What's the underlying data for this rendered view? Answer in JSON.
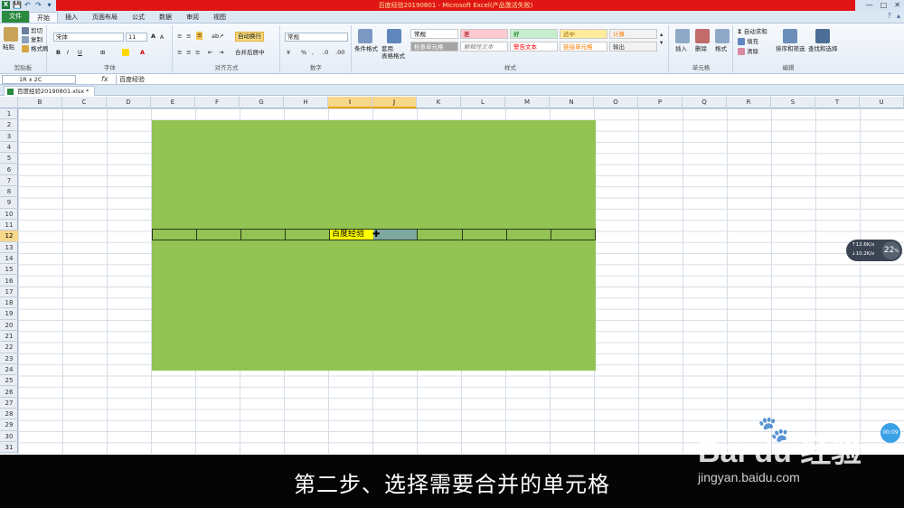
{
  "window": {
    "title": "百度经验20190801 - Microsoft Excel(产品激活失败)",
    "controls": [
      "—",
      "□",
      "✕"
    ]
  },
  "qat": {
    "excel_icon": "X",
    "save": "💾",
    "undo": "↶",
    "redo": "↷",
    "more": "▾"
  },
  "ribbon_tabs": [
    "文件",
    "开始",
    "插入",
    "页面布局",
    "公式",
    "数据",
    "审阅",
    "视图"
  ],
  "active_tab": "开始",
  "clipboard": {
    "paste": "粘贴",
    "cut": "剪切",
    "copy": "复制",
    "painter": "格式刷",
    "label": "剪贴板"
  },
  "font": {
    "name": "宋体",
    "size": "11",
    "grow": "A",
    "shrink": "A",
    "bold": "B",
    "italic": "I",
    "underline": "U",
    "label": "字体"
  },
  "alignment": {
    "wrap": "自动换行",
    "merge": "合并后居中",
    "label": "对齐方式"
  },
  "number": {
    "format": "常规",
    "percent": "%",
    "comma": ",",
    "label": "数字"
  },
  "styles": {
    "conditional": "条件格式",
    "table": "套用\n表格格式",
    "cells": [
      {
        "text": "常规",
        "bg": "#ffffff",
        "fg": "#000000"
      },
      {
        "text": "差",
        "bg": "#ffc7ce",
        "fg": "#9c0006"
      },
      {
        "text": "好",
        "bg": "#c6efce",
        "fg": "#006100"
      },
      {
        "text": "适中",
        "bg": "#ffeb9c",
        "fg": "#9c6500"
      },
      {
        "text": "计算",
        "bg": "#f2f2f2",
        "fg": "#fa7d00"
      },
      {
        "text": "检查单元格",
        "bg": "#a5a5a5",
        "fg": "#ffffff"
      },
      {
        "text": "解释性文本",
        "bg": "#ffffff",
        "fg": "#7f7f7f"
      },
      {
        "text": "警告文本",
        "bg": "#ffffff",
        "fg": "#ff0000"
      },
      {
        "text": "链接单元格",
        "bg": "#ffffff",
        "fg": "#fa7d00"
      },
      {
        "text": "输出",
        "bg": "#f2f2f2",
        "fg": "#3f3f3f"
      }
    ],
    "label": "样式"
  },
  "cells_group": {
    "insert": "插入",
    "delete": "删除",
    "format": "格式",
    "label": "单元格"
  },
  "editing": {
    "autosum": "自动求和",
    "fill": "填充",
    "clear": "清除",
    "sort": "排序和筛选",
    "find": "查找和选择",
    "label": "编辑"
  },
  "formula_bar": {
    "name_box": "1R x 2C",
    "fx": "fx",
    "content": "百度经验"
  },
  "workbook_tab": "百度经验20190801.xlsx *",
  "columns": [
    "B",
    "C",
    "D",
    "E",
    "F",
    "G",
    "H",
    "I",
    "J",
    "K",
    "L",
    "M",
    "N",
    "O",
    "P",
    "Q",
    "R",
    "S",
    "T",
    "U"
  ],
  "selected_columns": [
    "I",
    "J"
  ],
  "rows": [
    "1",
    "2",
    "3",
    "4",
    "5",
    "6",
    "7",
    "8",
    "9",
    "10",
    "11",
    "12",
    "13",
    "14",
    "15",
    "16",
    "17",
    "18",
    "19",
    "20",
    "21",
    "22",
    "23",
    "24",
    "25",
    "26",
    "27",
    "28",
    "29",
    "30",
    "31"
  ],
  "selected_row": "12",
  "active_cell_text": "百度经验",
  "sheet_colors": {
    "block": "#92c353",
    "active_cell": "#ffff00",
    "selection": "#7fa8a0"
  },
  "overlay": {
    "net_up": "↑12.6K/s",
    "net_down": "↓10.2K/s",
    "percent": "22",
    "percent_unit": "%",
    "timer": "00:09"
  },
  "caption": "第二步、选择需要合并的单元格",
  "watermark": {
    "logo": "Bai  du 经验",
    "url": "jingyan.baidu.com"
  }
}
